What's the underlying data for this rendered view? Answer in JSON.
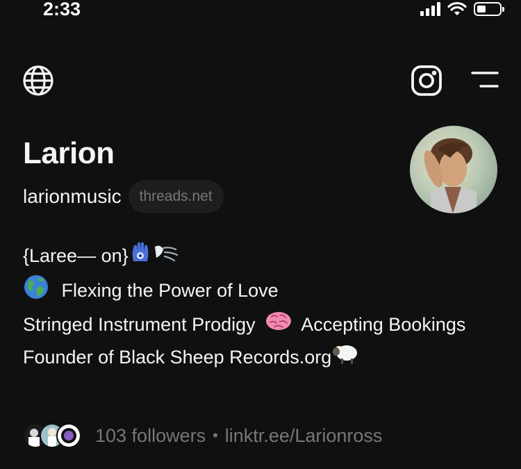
{
  "status_bar": {
    "time": "2:33"
  },
  "profile": {
    "display_name": "Larion",
    "username": "larionmusic",
    "domain_badge": "threads.net"
  },
  "bio": {
    "line1": "{Laree— on}",
    "line2": "Flexing the Power of Love",
    "line3a": "Stringed Instrument Prodigy",
    "line3b": "Accepting Bookings",
    "line4": "Founder of Black Sheep Records.org"
  },
  "stats": {
    "followers": "103 followers",
    "separator": "•",
    "link": "linktr.ee/Larionross"
  },
  "icons": {
    "top_left": "globe-icon",
    "top_right_1": "instagram-icon",
    "top_right_2": "menu-icon"
  },
  "colors": {
    "background": "#101010",
    "primary_text": "#f3f5f7",
    "secondary_text": "#777777",
    "pill_background": "#1e1e1e"
  }
}
